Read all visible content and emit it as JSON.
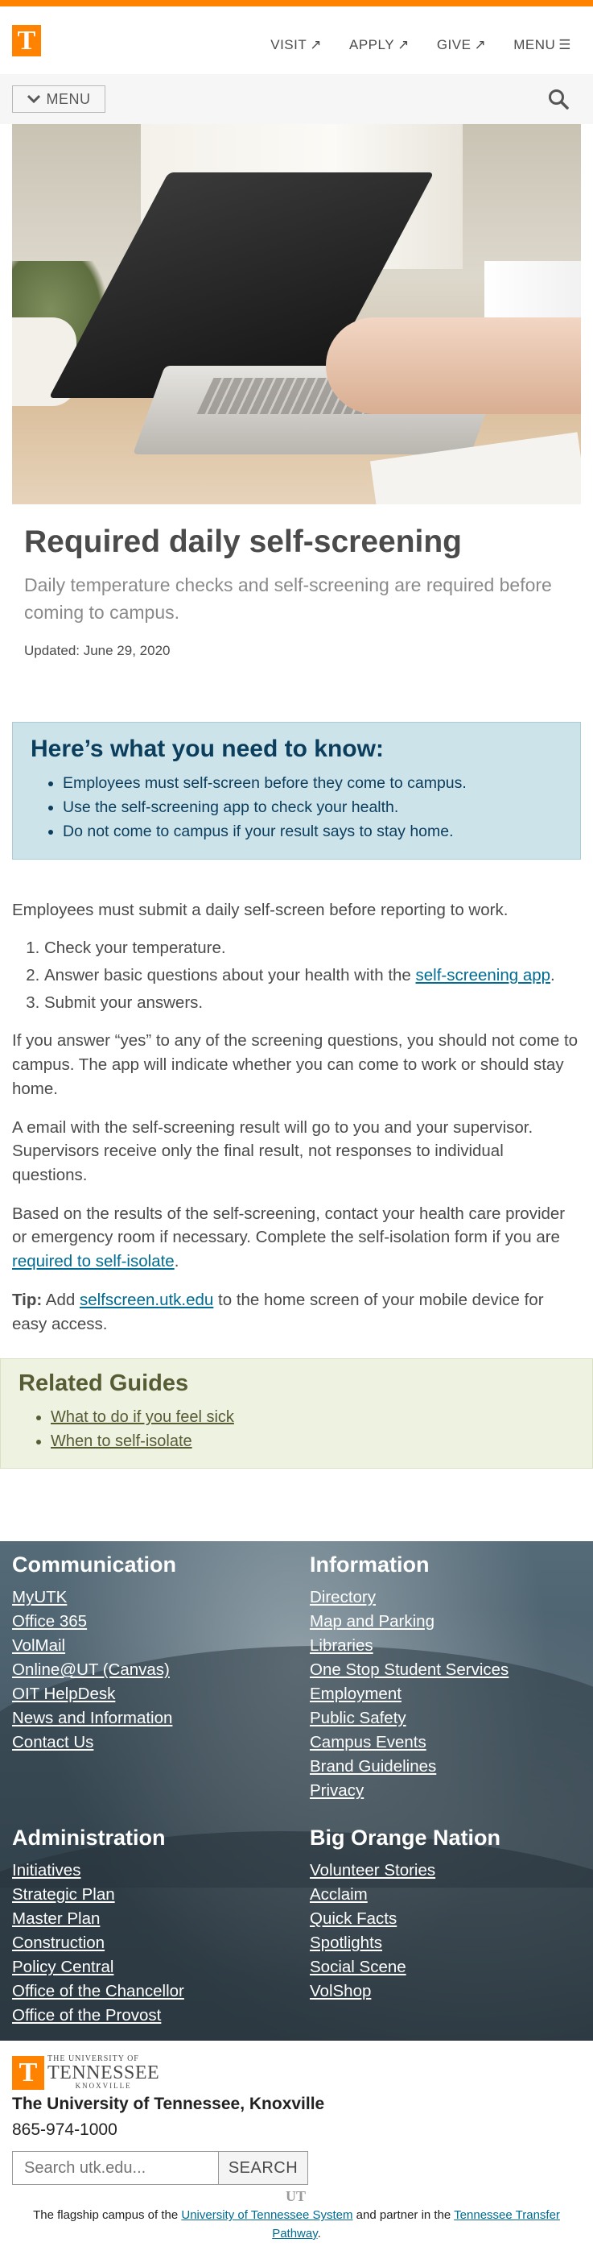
{
  "header": {
    "logo_letter": "T",
    "nav": [
      {
        "label": "VISIT",
        "icon": "↗"
      },
      {
        "label": "APPLY",
        "icon": "↗"
      },
      {
        "label": "GIVE",
        "icon": "↗"
      },
      {
        "label": "MENU",
        "icon": "☰"
      }
    ],
    "accent_color": "#ff8200"
  },
  "menubar": {
    "menu_label": "MENU",
    "icon_menu": "chevron-down-icon",
    "icon_search": "search-icon"
  },
  "hero": {
    "icon": "laptop-hero-image"
  },
  "page": {
    "title": "Required daily self-screening",
    "subtitle": "Daily temperature checks and self-screening are required before coming to campus.",
    "updated": "Updated: June 29, 2020"
  },
  "callout": {
    "heading": "Here’s what you need to know:",
    "items": [
      "Employees must self-screen before they come to campus.",
      "Use the self-screening app to check your health.",
      "Do not come to campus if your result says to stay home."
    ]
  },
  "content": {
    "intro": "Employees must submit a daily self-screen before reporting to work.",
    "steps": {
      "s1": "Check your temperature.",
      "s2_pre": "Answer basic questions about your health with the ",
      "s2_link": "self-screening app",
      "s2_post": ".",
      "s3": "Submit your answers."
    },
    "p1": "If you answer “yes” to any of the screening questions, you should not come to campus. The app will indicate whether you can come to work or should stay home.",
    "p2": "A email with the self-screening result will go to you and your supervisor. Supervisors receive only the final result, not responses to individual questions.",
    "p3_pre": "Based on the results of the self-screening, contact your health care provider or emergency room if necessary. Complete the self-isolation form if you are ",
    "p3_link": "required to self-isolate",
    "p3_post": ".",
    "tip_label": "Tip:",
    "tip_pre": " Add ",
    "tip_link": "selfscreen.utk.edu",
    "tip_post": " to the home screen of your mobile device for easy access."
  },
  "related": {
    "heading": "Related Guides",
    "links": [
      "What to do if you feel sick",
      "When to self-isolate"
    ]
  },
  "footer": {
    "communication": {
      "heading": "Communication",
      "links": [
        "MyUTK",
        "Office 365",
        "VolMail",
        "Online@UT (Canvas)",
        "OIT HelpDesk",
        "News and Information",
        "Contact Us"
      ]
    },
    "information": {
      "heading": "Information",
      "links": [
        "Directory",
        "Map and Parking",
        "Libraries",
        "One Stop Student Services",
        "Employment",
        "Public Safety",
        "Campus Events",
        "Brand Guidelines",
        "Privacy"
      ]
    },
    "administration": {
      "heading": "Administration",
      "links": [
        "Initiatives",
        "Strategic Plan",
        "Master Plan",
        "Construction",
        "Policy Central",
        "Office of the Chancellor",
        "Office of the Provost"
      ]
    },
    "big_orange": {
      "heading": "Big Orange Nation",
      "links": [
        "Volunteer Stories",
        "Acclaim",
        "Quick Facts",
        "Spotlights",
        "Social Scene",
        "VolShop"
      ]
    }
  },
  "bottom": {
    "logo_letter": "T",
    "logo_line1": "THE UNIVERSITY OF",
    "logo_line2": "TENNESSEE",
    "logo_line3": "KNOXVILLE",
    "university": "The University of Tennessee, Knoxville",
    "phone": "865-974-1000",
    "search_placeholder": "Search utk.edu...",
    "search_button": "SEARCH",
    "ut_mark": "UT",
    "flag_pre": "The flagship campus of the ",
    "flag_link1": "University of Tennessee System",
    "flag_mid": " and partner in the ",
    "flag_link2": "Tennessee Transfer Pathway",
    "flag_post": "."
  }
}
